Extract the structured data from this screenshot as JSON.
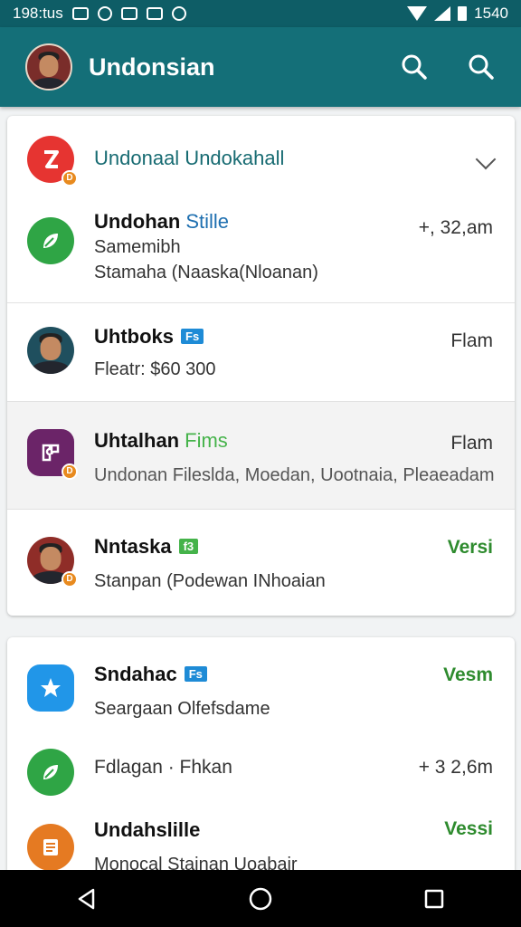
{
  "status_bar": {
    "time": "198:tus",
    "clock": "1540"
  },
  "app_bar": {
    "title": "Undonsian"
  },
  "group_header": {
    "title": "Undonaal Undokahall"
  },
  "items": [
    {
      "title": "Undohan",
      "title_extra": "Stille",
      "line1": "Samemibh",
      "line2": "Stamaha (Naaska(Nloanan)",
      "meta": "+, 32,am",
      "icon": "leaf-icon",
      "color": "#2fa545"
    },
    {
      "title": "Uhtboks",
      "tag": "Fs",
      "line1": "Fleatr: $60 300",
      "meta": "Flam",
      "icon": "person-avatar"
    },
    {
      "title": "Uhtalhan",
      "title_extra": "Fims",
      "line1": "Undonan Fileslda, Moedan, Uootnaia, Pleaeadam",
      "meta": "Flam",
      "icon": "puzzle-icon",
      "color": "#6b2468"
    },
    {
      "title": "Nntaska",
      "tag": "f3",
      "line1": "Stanpan (Podewan INhoaian",
      "meta": "Versi",
      "icon": "person-avatar-2"
    },
    {
      "title": "Sndahac",
      "tag": "Fs",
      "line1": "Seargaan Olfefsdame",
      "meta": "Vesm",
      "icon": "star-icon",
      "color": "#2196e8"
    },
    {
      "title": "Fdlagan · Fhkan",
      "meta": "+ 3 2,6m",
      "icon": "leaf-icon-2",
      "color": "#2fa545"
    },
    {
      "title": "Undahslille",
      "line1": "Monocal Stainan Uoabair",
      "meta": "Vessi",
      "icon": "note-icon",
      "color": "#e57a22"
    }
  ],
  "colors": {
    "appbar": "#146f78",
    "statusbar": "#0e5d66",
    "accent_green": "#2e8b2e"
  }
}
